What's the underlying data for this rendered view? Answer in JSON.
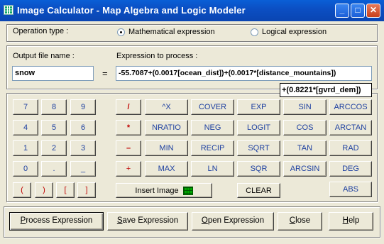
{
  "window": {
    "title": "Image Calculator - Map  Algebra and Logic Modeler"
  },
  "titlebar_buttons": {
    "minimize": "_",
    "maximize": "□",
    "close": "✕"
  },
  "operation": {
    "label": "Operation type :",
    "options": [
      {
        "label": "Mathematical expression",
        "selected": true
      },
      {
        "label": "Logical expression",
        "selected": false
      }
    ]
  },
  "output": {
    "label": "Output file name :",
    "value": "snow"
  },
  "equals": "=",
  "expression": {
    "label": "Expression to process :",
    "value": "-55.7087+(0.0017[ocean_dist])+(0.0017*[distance_mountains])",
    "overflow": "+(0.8221*[gvrd_dem])"
  },
  "keypad": {
    "digits": [
      "7",
      "8",
      "9",
      "4",
      "5",
      "6",
      "1",
      "2",
      "3",
      "0",
      ".",
      "_"
    ],
    "brackets": [
      "(",
      ")",
      "[",
      "]"
    ]
  },
  "operators": [
    "/",
    "*",
    "–",
    "+"
  ],
  "functions": {
    "row1": [
      "^X",
      "COVER",
      "EXP",
      "SIN",
      "ARCCOS"
    ],
    "row2": [
      "NRATIO",
      "NEG",
      "LOGIT",
      "COS",
      "ARCTAN"
    ],
    "row3": [
      "MIN",
      "RECIP",
      "SQRT",
      "TAN",
      "RAD"
    ],
    "row4": [
      "MAX",
      "LN",
      "SQR",
      "ARCSIN",
      "DEG"
    ],
    "abs": "ABS"
  },
  "insert_image": "Insert Image",
  "clear": "CLEAR",
  "actions": {
    "process": {
      "u": "P",
      "rest": "rocess Expression"
    },
    "save": {
      "u": "S",
      "rest": "ave Expression"
    },
    "open": {
      "u": "O",
      "rest": "pen Expression"
    },
    "close": {
      "u": "C",
      "rest": "lose"
    },
    "help": {
      "u": "H",
      "rest": "elp"
    }
  }
}
